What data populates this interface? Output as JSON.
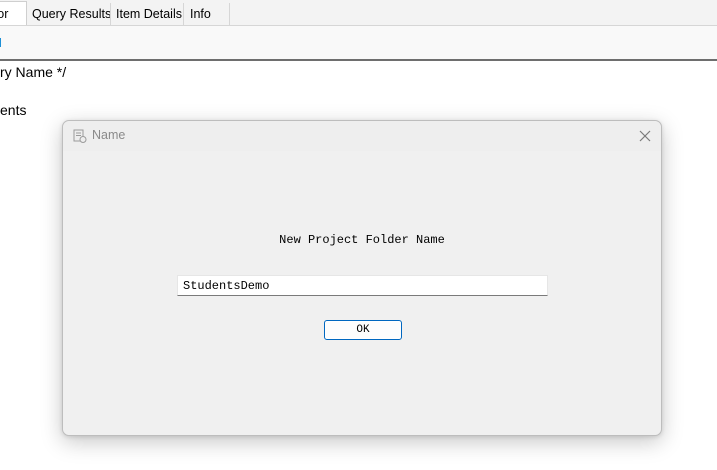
{
  "tabs": [
    {
      "label": "itor",
      "active": true
    },
    {
      "label": "Query Results",
      "active": false
    },
    {
      "label": "Item Details",
      "active": false
    },
    {
      "label": "Info",
      "active": false
    }
  ],
  "editor": {
    "lines": [
      "ry Name */",
      "ents"
    ]
  },
  "dialog": {
    "title": "Name",
    "app_icon": "app-icon",
    "close_icon": "close-icon",
    "prompt": "New Project Folder Name",
    "input_value": "StudentsDemo",
    "ok_label": "OK"
  },
  "colors": {
    "accent": "#0067c0",
    "toolbar_icon": "#1e90d6",
    "dialog_bg": "#f0f0f0"
  }
}
